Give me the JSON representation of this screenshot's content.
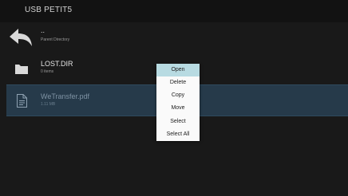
{
  "header": {
    "title": "USB PETIT5"
  },
  "colors": {
    "background": "#191919",
    "selected_row": "#263a4a",
    "menu_highlight": "#b8dbe2"
  },
  "file_list": {
    "items": [
      {
        "name": "..",
        "detail": "Parent Directory",
        "icon": "back-arrow-icon"
      },
      {
        "name": "LOST.DIR",
        "detail": "0 items",
        "icon": "folder-icon"
      },
      {
        "name": "WeTransfer.pdf",
        "detail": "1.11 MB",
        "icon": "document-icon",
        "selected": true
      }
    ]
  },
  "context_menu": {
    "items": [
      {
        "label": "Open",
        "highlighted": true
      },
      {
        "label": "Delete"
      },
      {
        "label": "Copy"
      },
      {
        "label": "Move"
      },
      {
        "label": "Select"
      },
      {
        "label": "Select All"
      }
    ]
  }
}
